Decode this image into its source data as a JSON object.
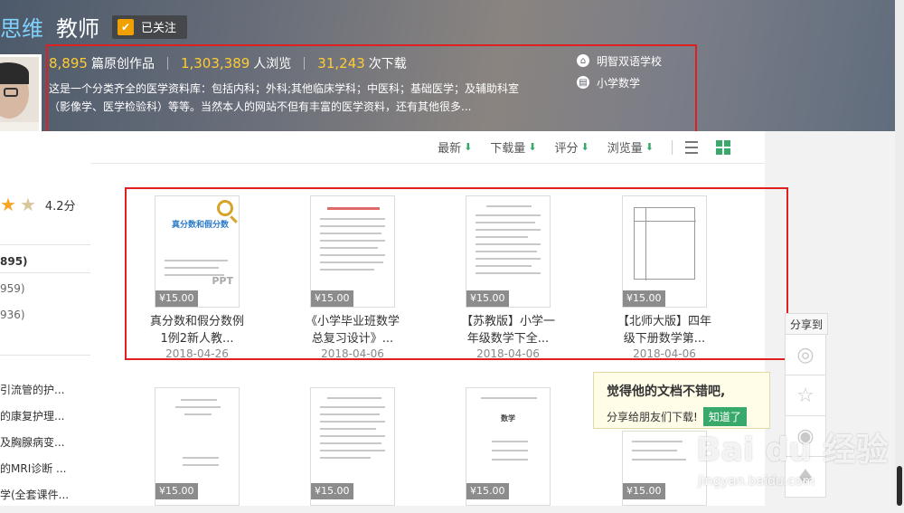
{
  "header": {
    "name": "思维",
    "role": "教师",
    "follow_label": "已关注",
    "stats": [
      {
        "num": "8,895",
        "label": "篇原创作品"
      },
      {
        "num": "1,303,389",
        "label": "人浏览"
      },
      {
        "num": "31,243",
        "label": "次下载"
      }
    ],
    "description": "这是一个分类齐全的医学资料库：包括内科；外科;其他临床学科；中医科；基础医学；及辅助科室（影像学、医学检验科）等等。当然本人的网站不但有丰富的医学资料，还有其他很多...",
    "school": "明智双语学校",
    "subject": "小学数学"
  },
  "sidebar": {
    "rating": "4.2分",
    "count_total": "895)",
    "count_a": "959)",
    "count_b": "936)",
    "items": [
      "引流管的护...",
      "的康复护理...",
      "及胸腺病变...",
      "的MRI诊断 ...",
      "学(全套课件..."
    ]
  },
  "sortbar": {
    "items": [
      "最新",
      "下载量",
      "评分",
      "浏览量"
    ]
  },
  "docs_row1": [
    {
      "price": "¥15.00",
      "title_l1": "真分数和假分数例",
      "title_l2": "1例2新人教...",
      "date": "2018-04-26",
      "thumb_title": "真分数和假分数",
      "thumb_tag": "PPT"
    },
    {
      "price": "¥15.00",
      "title_l1": "《小学毕业班数学",
      "title_l2": "总复习设计》...",
      "date": "2018-04-06"
    },
    {
      "price": "¥15.00",
      "title_l1": "【苏教版】小学一",
      "title_l2": "年级数学下全...",
      "date": "2018-04-06"
    },
    {
      "price": "¥15.00",
      "title_l1": "【北师大版】四年",
      "title_l2": "级下册数学第...",
      "date": "2018-04-06"
    }
  ],
  "docs_row2": [
    {
      "price": "¥15.00"
    },
    {
      "price": "¥15.00"
    },
    {
      "price": "¥15.00",
      "thumb_title": "数学"
    },
    {
      "price": "¥15.00"
    }
  ],
  "share": {
    "label": "分享到"
  },
  "tooltip": {
    "line1": "觉得他的文档不错吧,",
    "line2": "分享给朋友们下载!",
    "ok": "知道了"
  },
  "watermark": {
    "main": "Bai du 经验",
    "sub": "jingyan.baidu.com"
  },
  "colors": {
    "accent_green": "#39a96b",
    "stat_yellow": "#ffcc33",
    "highlight_red": "#e02020"
  }
}
